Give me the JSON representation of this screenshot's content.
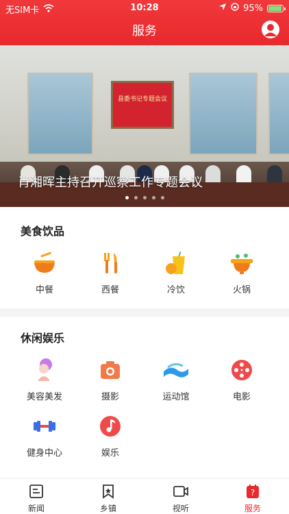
{
  "status_bar": {
    "carrier": "无SIM卡",
    "time": "10:28",
    "battery": "95%"
  },
  "nav": {
    "title": "服务"
  },
  "banner": {
    "caption": "肖湘晖主持召开巡察工作专题会议",
    "board_text": "县委书记专题会议",
    "dots": 5,
    "active_dot": 0
  },
  "food": {
    "title": "美食饮品",
    "items": [
      {
        "label": "中餐",
        "icon": "noodle-bowl-icon"
      },
      {
        "label": "西餐",
        "icon": "fork-knife-icon"
      },
      {
        "label": "冷饮",
        "icon": "cold-drink-icon"
      },
      {
        "label": "火锅",
        "icon": "hotpot-icon"
      }
    ]
  },
  "leisure": {
    "title": "休闲娱乐",
    "items": [
      {
        "label": "美容美发",
        "icon": "beauty-icon"
      },
      {
        "label": "摄影",
        "icon": "camera-icon"
      },
      {
        "label": "运动馆",
        "icon": "wave-icon"
      },
      {
        "label": "电影",
        "icon": "film-reel-icon"
      },
      {
        "label": "健身中心",
        "icon": "dumbbell-icon"
      },
      {
        "label": "娱乐",
        "icon": "music-note-icon"
      }
    ]
  },
  "tabbar": {
    "items": [
      {
        "label": "新闻",
        "icon": "news-icon"
      },
      {
        "label": "乡镇",
        "icon": "bookmark-star-icon"
      },
      {
        "label": "视听",
        "icon": "video-icon"
      },
      {
        "label": "服务",
        "icon": "service-icon"
      }
    ],
    "active": 3
  },
  "colors": {
    "primary": "#e8292d",
    "gap": "#f4f4f4"
  }
}
